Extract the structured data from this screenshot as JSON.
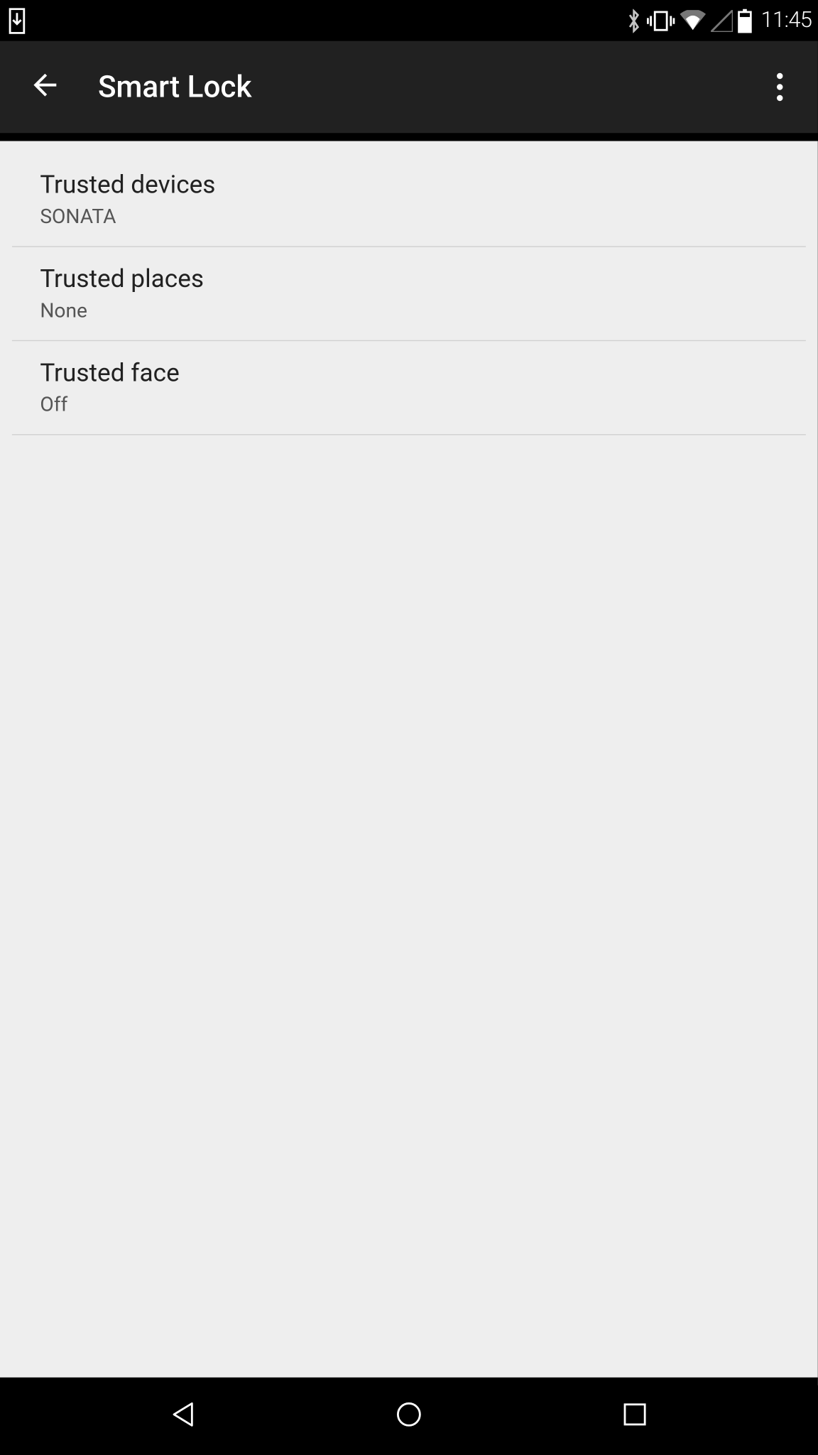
{
  "status_bar": {
    "clock": "11:45",
    "icons": {
      "download_box": "download-box-icon",
      "bluetooth": "bluetooth-icon",
      "vibrate": "vibrate-icon",
      "wifi": "wifi-icon",
      "cell": "cell-signal-icon",
      "battery": "battery-icon"
    }
  },
  "app_bar": {
    "title": "Smart Lock"
  },
  "settings": {
    "items": [
      {
        "title": "Trusted devices",
        "summary": "SONATA"
      },
      {
        "title": "Trusted places",
        "summary": "None"
      },
      {
        "title": "Trusted face",
        "summary": "Off"
      }
    ]
  }
}
